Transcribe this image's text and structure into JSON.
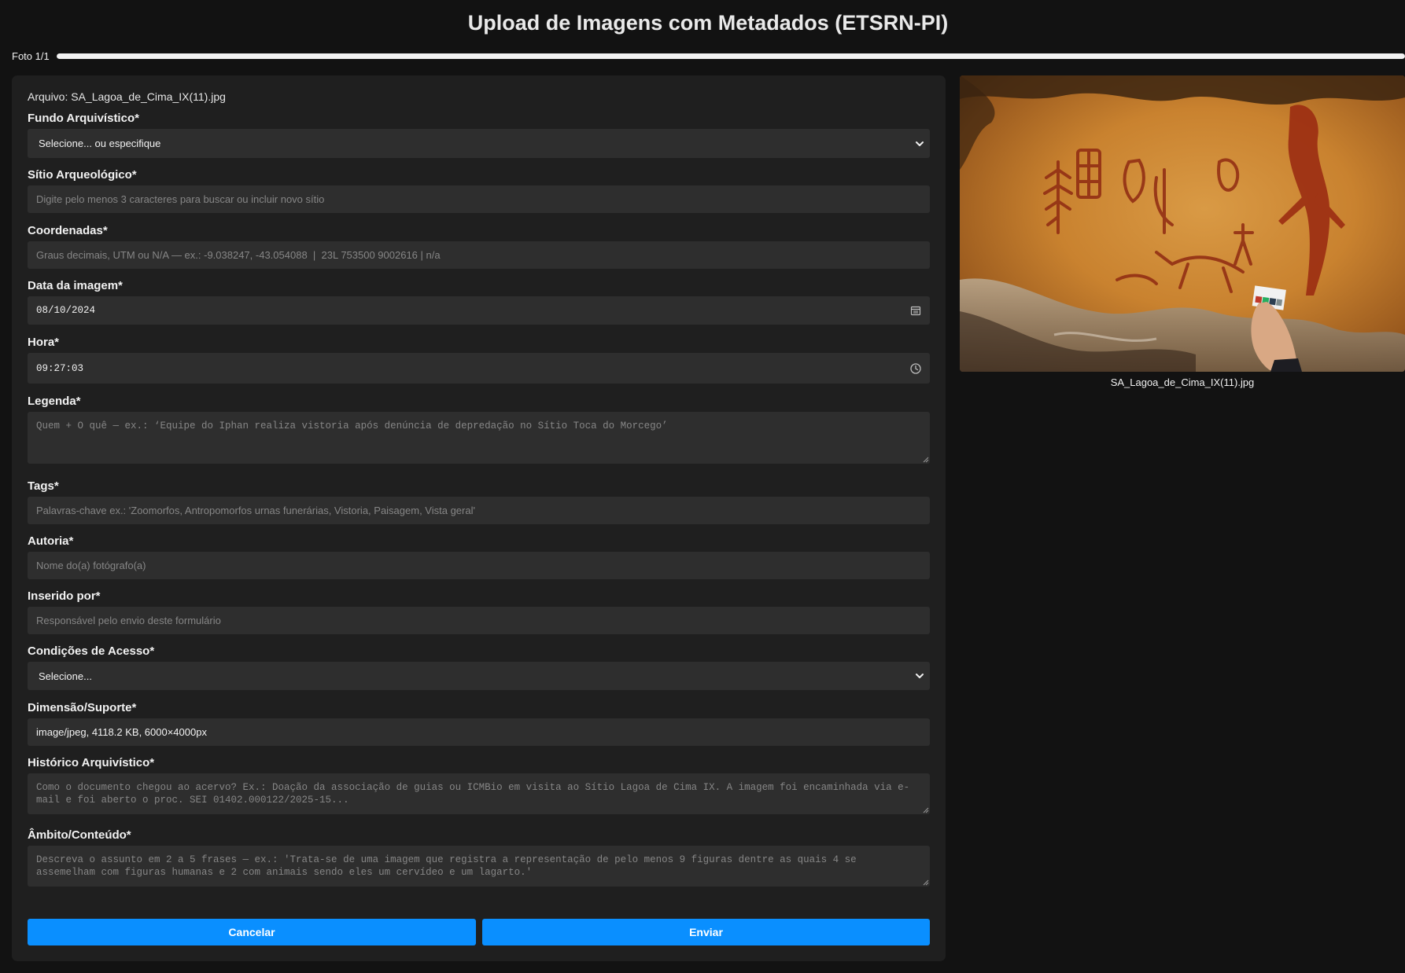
{
  "page_title": "Upload de Imagens com Metadados (ETSRN-PI)",
  "progress": {
    "label": "Foto 1/1",
    "fraction": 1.0
  },
  "file_line": "Arquivo: SA_Lagoa_de_Cima_IX(11).jpg",
  "fields": {
    "fundo": {
      "label": "Fundo Arquivístico*",
      "selected": "Selecione... ou especifique"
    },
    "sitio": {
      "label": "Sítio Arqueológico*",
      "placeholder": "Digite pelo menos 3 caracteres para buscar ou incluir novo sítio"
    },
    "coordenadas": {
      "label": "Coordenadas*",
      "placeholder": "Graus decimais, UTM ou N/A — ex.: -9.038247, -43.054088  |  23L 753500 9002616 | n/a"
    },
    "data": {
      "label": "Data da imagem*",
      "value": "08/10/2024"
    },
    "hora": {
      "label": "Hora*",
      "value": "09:27:03"
    },
    "legenda": {
      "label": "Legenda*",
      "placeholder": "Quem + O quê — ex.: ‘Equipe do Iphan realiza vistoria após denúncia de depredação no Sítio Toca do Morcego’"
    },
    "tags": {
      "label": "Tags*",
      "placeholder": "Palavras-chave ex.: 'Zoomorfos, Antropomorfos urnas funerárias, Vistoria, Paisagem, Vista geral'"
    },
    "autoria": {
      "label": "Autoria*",
      "placeholder": "Nome do(a) fotógrafo(a)"
    },
    "inserido": {
      "label": "Inserido por*",
      "placeholder": "Responsável pelo envio deste formulário"
    },
    "condicoes": {
      "label": "Condições de Acesso*",
      "selected": "Selecione..."
    },
    "dimensao": {
      "label": "Dimensão/Suporte*",
      "value": "image/jpeg, 4118.2 KB, 6000×4000px"
    },
    "historico": {
      "label": "Histórico Arquivístico*",
      "placeholder": "Como o documento chegou ao acervo? Ex.: Doação da associação de guias ou ICMBio em visita ao Sítio Lagoa de Cima IX. A imagem foi encaminhada via e-mail e foi aberto o proc. SEI 01402.000122/2025-15..."
    },
    "ambito": {
      "label": "Âmbito/Conteúdo*",
      "placeholder": "Descreva o assunto em 2 a 5 frases — ex.: 'Trata-se de uma imagem que registra a representação de pelo menos 9 figuras dentre as quais 4 se assemelham com figuras humanas e 2 com animais sendo eles um cervídeo e um lagarto.'"
    }
  },
  "buttons": {
    "cancel": "Cancelar",
    "submit": "Enviar"
  },
  "preview": {
    "caption": "SA_Lagoa_de_Cima_IX(11).jpg"
  },
  "colors": {
    "accent": "#0a8fff",
    "background": "#121212",
    "card": "#1f1f1f",
    "input": "#2e2e2e"
  },
  "icons": {
    "select_arrow": "chevron-down-icon",
    "date": "calendar-icon",
    "time": "clock-icon"
  }
}
